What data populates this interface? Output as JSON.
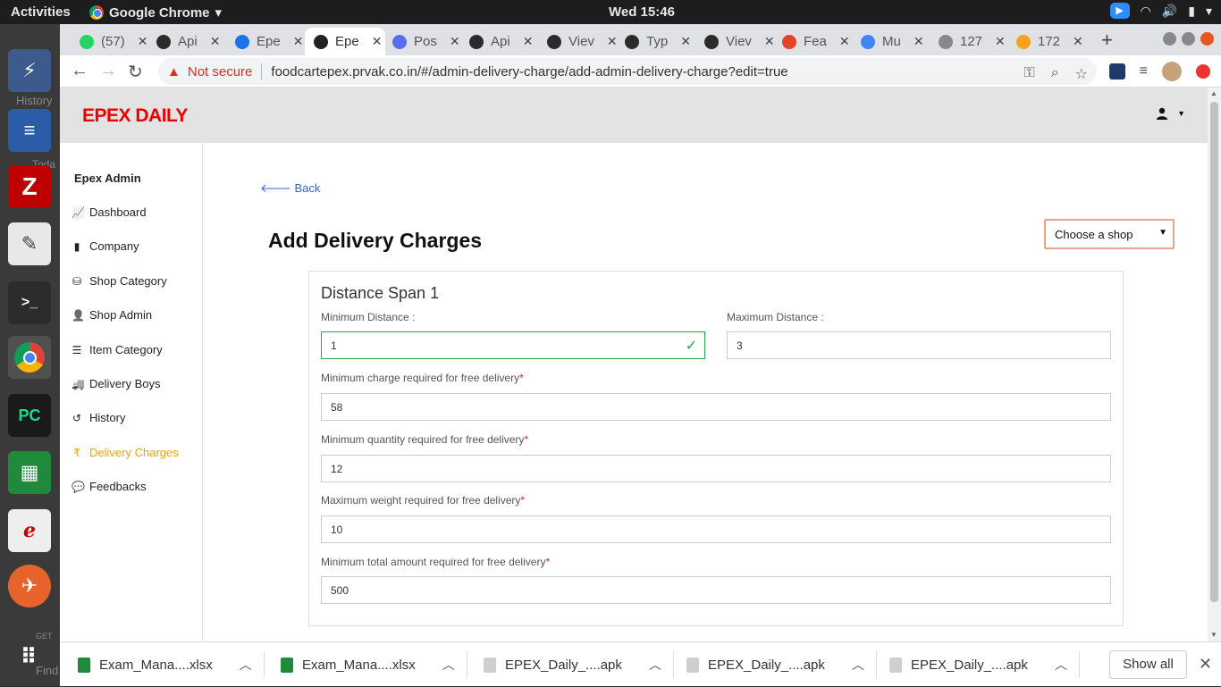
{
  "os": {
    "activities": "Activities",
    "app_name": "Google Chrome",
    "clock": "Wed 15:46"
  },
  "tabs": [
    {
      "label": "(57)",
      "color": "#25d366"
    },
    {
      "label": "Api",
      "color": "#2b2b2b"
    },
    {
      "label": "Epe",
      "color": "#1a73e8"
    },
    {
      "label": "Epe",
      "color": "#222222",
      "active": true
    },
    {
      "label": "Pos",
      "color": "#5b6cf0"
    },
    {
      "label": "Api",
      "color": "#2b2b2b"
    },
    {
      "label": "Viev",
      "color": "#2b2b2b"
    },
    {
      "label": "Typ",
      "color": "#2b2b2b"
    },
    {
      "label": "Viev",
      "color": "#2b2b2b"
    },
    {
      "label": "Fea",
      "color": "#e24329"
    },
    {
      "label": "Mu",
      "color": "#4285f4"
    },
    {
      "label": "127",
      "color": "#888888"
    },
    {
      "label": "172",
      "color": "#f6a21e"
    }
  ],
  "address": {
    "security": "Not secure",
    "url": "foodcartepex.prvak.co.in/#/admin-delivery-charge/add-admin-delivery-charge?edit=true"
  },
  "app": {
    "brand": "EPEX DAILY",
    "brand_color": "#e00000"
  },
  "sidebar": {
    "title": "Epex Admin",
    "items": [
      {
        "label": "Dashboard",
        "icon": "chart-line-icon"
      },
      {
        "label": "Company",
        "icon": "building-icon"
      },
      {
        "label": "Shop Category",
        "icon": "basket-icon"
      },
      {
        "label": "Shop Admin",
        "icon": "user-gear-icon"
      },
      {
        "label": "Item Category",
        "icon": "list-icon"
      },
      {
        "label": "Delivery Boys",
        "icon": "truck-icon"
      },
      {
        "label": "History",
        "icon": "history-icon"
      },
      {
        "label": "Delivery Charges",
        "icon": "rupee-icon",
        "active": true
      },
      {
        "label": "Feedbacks",
        "icon": "comment-icon"
      }
    ],
    "active_color": "#f0a30a"
  },
  "main": {
    "back_label": "Back",
    "title": "Add Delivery Charges",
    "shop_select": "Choose a shop",
    "card_title": "Distance Span 1",
    "fields": {
      "min_distance": {
        "label": "Minimum Distance :",
        "value": "1"
      },
      "max_distance": {
        "label": "Maximum Distance :",
        "value": "3"
      },
      "min_charge": {
        "label": "Minimum charge required for free delivery",
        "value": "58"
      },
      "min_quantity": {
        "label": "Minimum quantity required for free delivery",
        "value": "12"
      },
      "max_weight": {
        "label": "Maximum weight required for free delivery",
        "value": "10"
      },
      "min_total": {
        "label": "Minimum total amount required for free delivery",
        "value": "500"
      }
    },
    "required_mark": "*"
  },
  "downloads": {
    "items": [
      {
        "name": "Exam_Mana....xlsx",
        "type": "xlsx"
      },
      {
        "name": "Exam_Mana....xlsx",
        "type": "xlsx"
      },
      {
        "name": "EPEX_Daily_....apk",
        "type": "apk"
      },
      {
        "name": "EPEX_Daily_....apk",
        "type": "apk"
      },
      {
        "name": "EPEX_Daily_....apk",
        "type": "apk"
      }
    ],
    "show_all": "Show all"
  },
  "dock_ghost_text": {
    "history": "History",
    "today": "Toda",
    "get": "GET",
    "find": "Find"
  }
}
